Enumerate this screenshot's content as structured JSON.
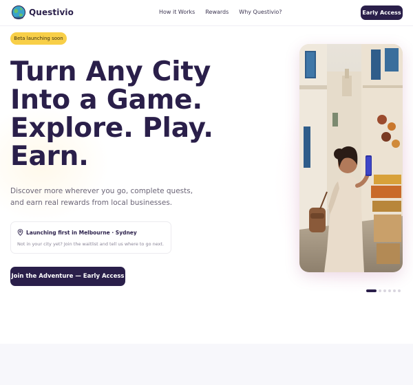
{
  "brand": {
    "name": "Questivio",
    "icon": "globe-icon"
  },
  "nav": {
    "links": [
      "How it Works",
      "Rewards",
      "Why Questivio?"
    ],
    "cta": "Early Access"
  },
  "hero": {
    "badge": "Beta launching soon",
    "headline": [
      "Turn Any City",
      "Into a Game.",
      "Explore. Play.",
      "Earn."
    ],
    "subtext": "Discover more wherever you go, complete quests, and earn real rewards from local businesses.",
    "launch": {
      "icon": "map-pin-icon",
      "title": "Launching first in Melbourne · Sydney",
      "subtitle": "Not in your city yet? Join the waitlist and tell us where to go next."
    },
    "cta": "Join the Adventure — Early Access"
  },
  "carousel": {
    "slide_count": 6,
    "active_index": 0
  },
  "colors": {
    "primary": "#2a1f4a",
    "badge": "#f8cf48",
    "text_muted": "#6b6577"
  }
}
